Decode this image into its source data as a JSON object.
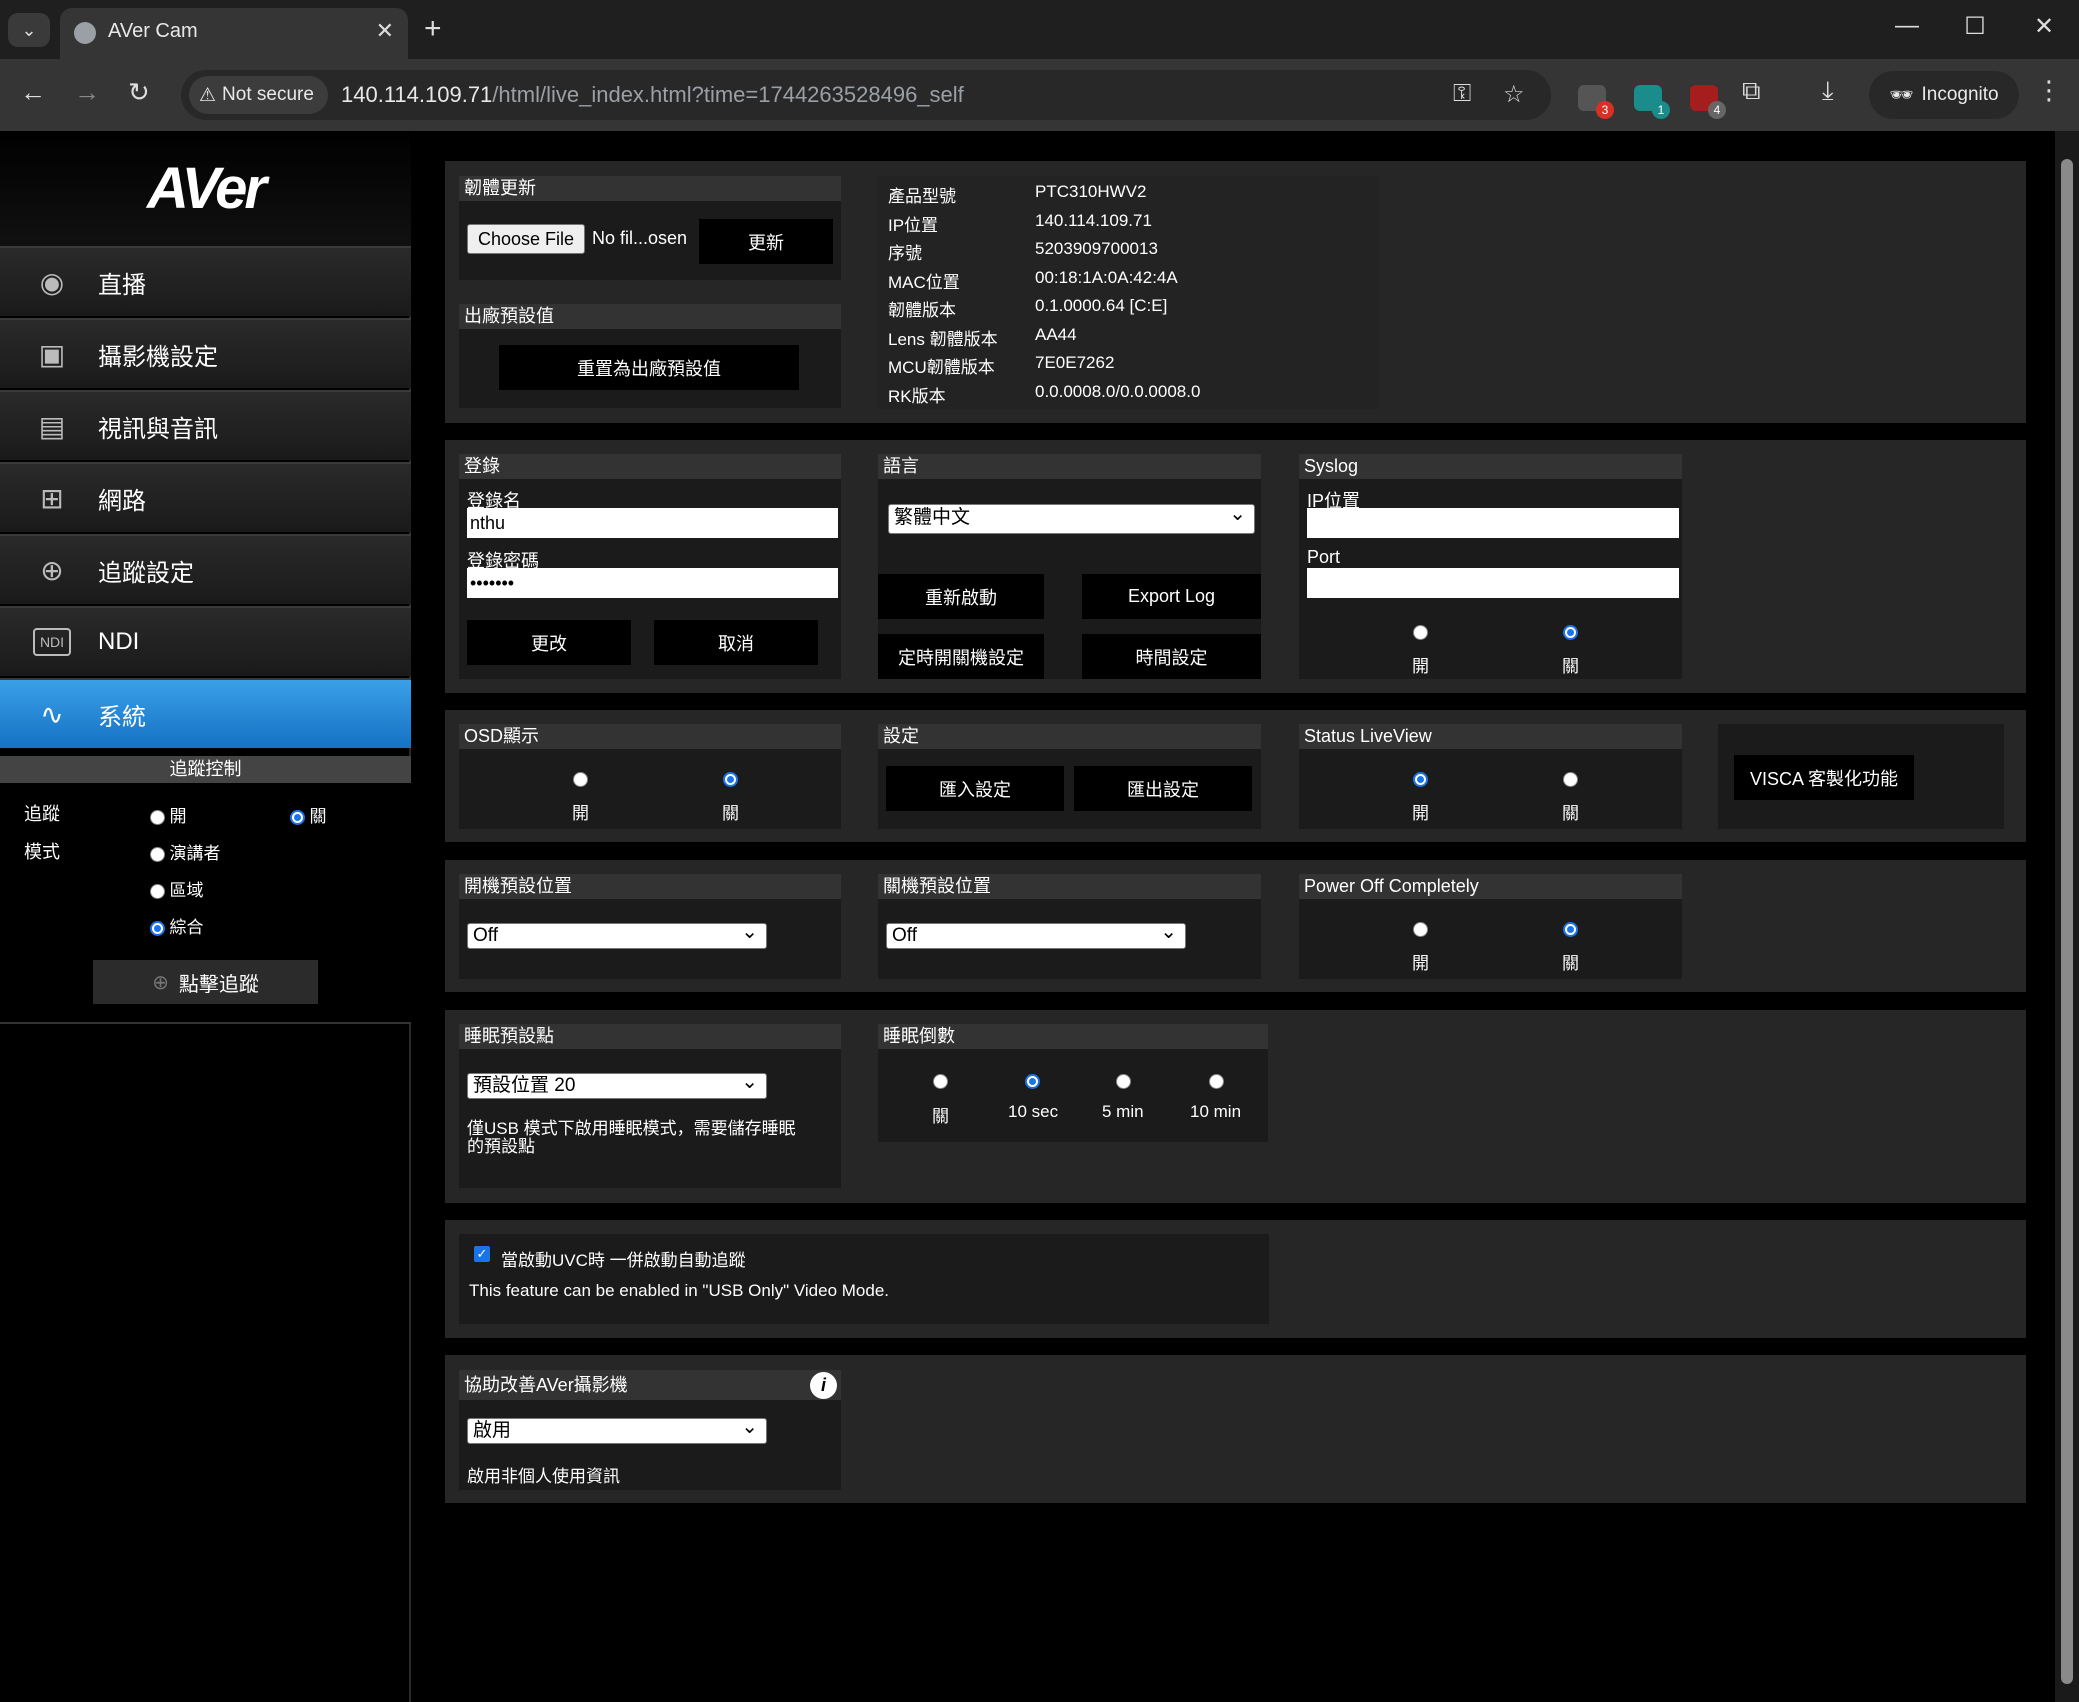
{
  "browser": {
    "tab_title": "AVer Cam",
    "security_label": "Not secure",
    "url_host": "140.114.109.71",
    "url_path": "/html/live_index.html?time=1744263528496_self",
    "incognito_label": "Incognito",
    "ext_badges": [
      "3",
      "1",
      "4"
    ]
  },
  "sidebar": {
    "logo": "AVer",
    "items": [
      {
        "label": "直播",
        "icon": "eye-icon"
      },
      {
        "label": "攝影機設定",
        "icon": "image-icon"
      },
      {
        "label": "視訊與音訊",
        "icon": "video-audio-icon"
      },
      {
        "label": "網路",
        "icon": "network-icon"
      },
      {
        "label": "追蹤設定",
        "icon": "tracking-target-icon"
      },
      {
        "label": "NDI",
        "icon": "ndi-icon"
      },
      {
        "label": "系統",
        "icon": "pulse-icon"
      }
    ],
    "tracking": {
      "header": "追蹤控制",
      "track_label": "追蹤",
      "on": "開",
      "off": "關",
      "mode_label": "模式",
      "mode_presenter": "演講者",
      "mode_zone": "區域",
      "mode_hybrid": "綜合",
      "click_track": "點擊追蹤"
    }
  },
  "firmware": {
    "title": "韌體更新",
    "choose_file": "Choose File",
    "no_file": "No fil...osen",
    "update": "更新"
  },
  "factory": {
    "title": "出廠預設值",
    "reset": "重置為出廠預設值"
  },
  "device_info": {
    "rows": [
      {
        "k": "產品型號",
        "v": "PTC310HWV2"
      },
      {
        "k": "IP位置",
        "v": "140.114.109.71"
      },
      {
        "k": "序號",
        "v": "5203909700013"
      },
      {
        "k": "MAC位置",
        "v": "00:18:1A:0A:42:4A"
      },
      {
        "k": "韌體版本",
        "v": "0.1.0000.64 [C:E]"
      },
      {
        "k": "Lens 韌體版本",
        "v": "AA44"
      },
      {
        "k": "MCU韌體版本",
        "v": "7E0E7262"
      },
      {
        "k": "RK版本",
        "v": "0.0.0008.0/0.0.0008.0"
      }
    ]
  },
  "login": {
    "title": "登錄",
    "username_label": "登錄名",
    "username": "nthu",
    "password_label": "登錄密碼",
    "password": "•••••••",
    "change": "更改",
    "cancel": "取消"
  },
  "language": {
    "title": "語言",
    "selected": "繁體中文",
    "restart": "重新啟動",
    "export_log": "Export Log",
    "schedule": "定時開關機設定",
    "time": "時間設定"
  },
  "syslog": {
    "title": "Syslog",
    "ip_label": "IP位置",
    "port_label": "Port",
    "on": "開",
    "off": "關"
  },
  "osd": {
    "title": "OSD顯示",
    "on": "開",
    "off": "關"
  },
  "settings": {
    "title": "設定",
    "import": "匯入設定",
    "export": "匯出設定"
  },
  "status_liveview": {
    "title": "Status LiveView",
    "on": "開",
    "off": "關"
  },
  "visca": {
    "label": "VISCA 客製化功能"
  },
  "poweron_preset": {
    "title": "開機預設位置",
    "selected": "Off"
  },
  "poweroff_preset": {
    "title": "關機預設位置",
    "selected": "Off"
  },
  "power_off_completely": {
    "title": "Power Off Completely",
    "on": "開",
    "off": "關"
  },
  "sleep_preset": {
    "title": "睡眠預設點",
    "selected": "預設位置 20",
    "note_line1": "僅USB 模式下啟用睡眠模式，需要儲存睡眠",
    "note_line2": "的預設點"
  },
  "sleep_countdown": {
    "title": "睡眠倒數",
    "options": [
      "關",
      "10 sec",
      "5 min",
      "10 min"
    ]
  },
  "uvc": {
    "label": "當啟動UVC時 一併啟動自動追蹤",
    "note": "This feature can be enabled in \"USB Only\" Video Mode."
  },
  "improve": {
    "title": "協助改善AVer攝影機",
    "selected": "啟用",
    "note": "啟用非個人使用資訊"
  }
}
